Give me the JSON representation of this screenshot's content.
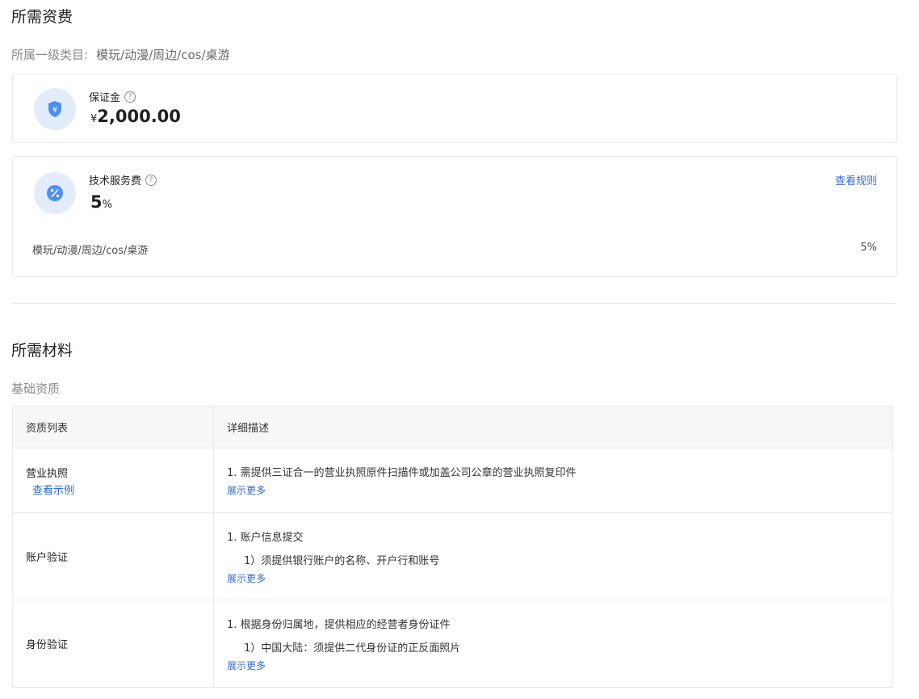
{
  "fees": {
    "title": "所需资费",
    "category_label": "所属一级类目:",
    "category_value": "模玩/动漫/周边/cos/桌游",
    "deposit": {
      "label": "保证金",
      "currency": "¥",
      "amount": "2,000.00",
      "icon": "shield-yen-icon",
      "help_icon": "?"
    },
    "service_fee": {
      "label": "技术服务费",
      "rate": "5",
      "unit": "%",
      "icon": "percent-icon",
      "help_icon": "?",
      "rule_link": "查看规则",
      "rows": [
        {
          "category": "模玩/动漫/周边/cos/桌游",
          "rate": "5%"
        }
      ]
    }
  },
  "materials": {
    "title": "所需材料",
    "subtitle": "基础资质",
    "columns": [
      "资质列表",
      "详细描述"
    ],
    "rows": [
      {
        "name": "营业执照",
        "example_link": "查看示例",
        "desc": "1. 需提供三证合一的营业执照原件扫描件或加盖公司公章的营业执照复印件",
        "more": "展示更多"
      },
      {
        "name": "账户验证",
        "desc": "1. 账户信息提交",
        "sub": "1）须提供银行账户的名称、开户行和账号",
        "more": "展示更多"
      },
      {
        "name": "身份验证",
        "desc": "1. 根据身份归属地，提供相应的经营者身份证件",
        "sub": "1）中国大陆：须提供二代身份证的正反面照片",
        "more": "展示更多"
      }
    ]
  },
  "colors": {
    "accent": "#2f6bd8",
    "icon_bg": "#e2ecfb",
    "icon_fg": "#4f8ef0"
  }
}
